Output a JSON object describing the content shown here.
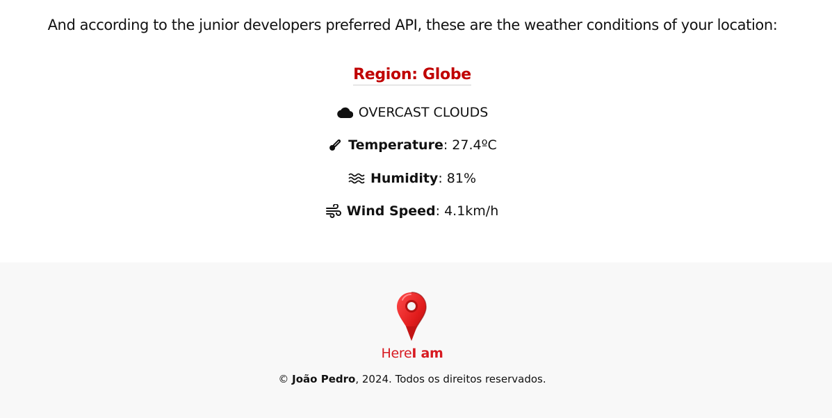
{
  "intro_text": "And according to the junior developers preferred API, these are the weather conditions of your location:",
  "weather": {
    "region_label": "Region: Globe",
    "condition": "OVERCAST CLOUDS",
    "temperature": {
      "label": "Temperature",
      "value": ": 27.4ºC"
    },
    "humidity": {
      "label": "Humidity",
      "value": ": 81%"
    },
    "wind_speed": {
      "label": "Wind Speed",
      "value": ": 4.1km/h"
    },
    "icons": {
      "condition": "cloud-icon",
      "temperature": "thermometer-icon",
      "humidity": "water-waves-icon",
      "wind_speed": "wind-icon"
    }
  },
  "footer": {
    "logo": {
      "icon": "map-pin-icon",
      "brand_part1": "Here",
      "brand_part2": "I am"
    },
    "copyright_symbol": "© ",
    "copyright_author": "João Pedro",
    "copyright_rest": ", 2024. Todos os direitos reservados."
  },
  "colors": {
    "accent_red": "#c00000",
    "brand_red": "#d71920",
    "footer_bg": "#f8f8f8"
  }
}
